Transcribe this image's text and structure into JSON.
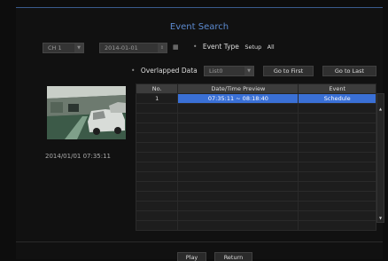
{
  "header": {
    "title": "Event Search"
  },
  "filters": {
    "channel": "CH 1",
    "date": "2014-01-01",
    "event_type_label": "Event Type",
    "setup_label": "Setup",
    "event_type_value": "All"
  },
  "overlap": {
    "label": "Overlapped Data",
    "list_value": "List0",
    "go_first": "Go to First",
    "go_last": "Go to Last"
  },
  "preview": {
    "timestamp": "2014/01/01 07:35:11"
  },
  "table": {
    "columns": [
      "No.",
      "Date/Time Preview",
      "Event"
    ],
    "rows": [
      {
        "no": "1",
        "time": "07:35:11 ~ 08:18:40",
        "event": "Schedule"
      }
    ]
  },
  "footer": {
    "play": "Play",
    "return": "Return"
  },
  "colors": {
    "accent": "#5c8ad0",
    "selection": "#3a70d6"
  }
}
